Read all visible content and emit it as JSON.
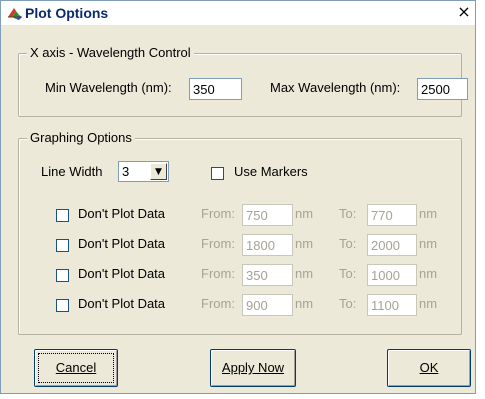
{
  "window": {
    "title": "Plot Options",
    "close_glyph": "×"
  },
  "xaxis_group": {
    "legend": "X axis - Wavelength Control",
    "min_label": "Min Wavelength (nm):",
    "min_value": "350",
    "max_label": "Max Wavelength (nm):",
    "max_value": "2500"
  },
  "graphing_group": {
    "legend": "Graphing Options",
    "line_width_label": "Line Width",
    "line_width_value": "3",
    "dropdown_arrow": "▼",
    "use_markers_label": "Use Markers",
    "use_markers_checked": false,
    "rows": [
      {
        "label": "Don't Plot Data",
        "from_label": "From:",
        "from_value": "750",
        "unit1": "nm",
        "to_label": "To:",
        "to_value": "770",
        "unit2": "nm"
      },
      {
        "label": "Don't Plot Data",
        "from_label": "From:",
        "from_value": "1800",
        "unit1": "nm",
        "to_label": "To:",
        "to_value": "2000",
        "unit2": "nm"
      },
      {
        "label": "Don't Plot Data",
        "from_label": "From:",
        "from_value": "350",
        "unit1": "nm",
        "to_label": "To:",
        "to_value": "1000",
        "unit2": "nm"
      },
      {
        "label": "Don't Plot Data",
        "from_label": "From:",
        "from_value": "900",
        "unit1": "nm",
        "to_label": "To:",
        "to_value": "1100",
        "unit2": "nm"
      }
    ]
  },
  "buttons": {
    "cancel": "Cancel",
    "apply": "Apply Now",
    "ok": "OK"
  },
  "colors": {
    "dialog_bg": "#ece9d8",
    "title_text": "#0a2a6e",
    "disabled_text": "#a6a394"
  }
}
